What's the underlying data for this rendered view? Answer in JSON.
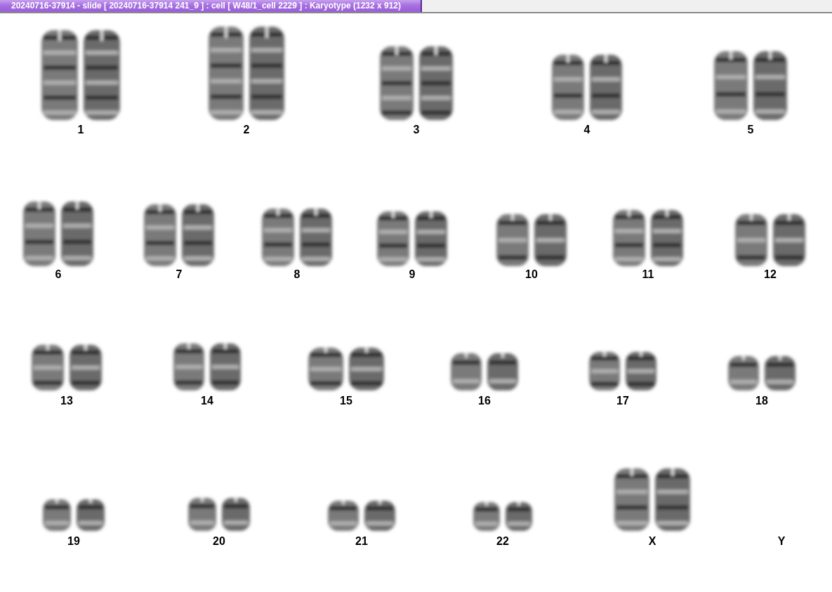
{
  "window": {
    "title": "20240716-37914 - slide [ 20240716-37914 241_9 ] : cell [ W48/1_cell 2229 ] : Karyotype  (1232 x 912)"
  },
  "karyotype": [
    {
      "label": "1",
      "pair_shown": true
    },
    {
      "label": "2",
      "pair_shown": true
    },
    {
      "label": "3",
      "pair_shown": true
    },
    {
      "label": "4",
      "pair_shown": true
    },
    {
      "label": "5",
      "pair_shown": true
    },
    {
      "label": "6",
      "pair_shown": true
    },
    {
      "label": "7",
      "pair_shown": true
    },
    {
      "label": "8",
      "pair_shown": true
    },
    {
      "label": "9",
      "pair_shown": true
    },
    {
      "label": "10",
      "pair_shown": true
    },
    {
      "label": "11",
      "pair_shown": true
    },
    {
      "label": "12",
      "pair_shown": true
    },
    {
      "label": "13",
      "pair_shown": true
    },
    {
      "label": "14",
      "pair_shown": true
    },
    {
      "label": "15",
      "pair_shown": true
    },
    {
      "label": "16",
      "pair_shown": true
    },
    {
      "label": "17",
      "pair_shown": true
    },
    {
      "label": "18",
      "pair_shown": true
    },
    {
      "label": "19",
      "pair_shown": true
    },
    {
      "label": "20",
      "pair_shown": true
    },
    {
      "label": "21",
      "pair_shown": true
    },
    {
      "label": "22",
      "pair_shown": true
    },
    {
      "label": "X",
      "pair_shown": true
    },
    {
      "label": "Y",
      "pair_shown": false
    }
  ]
}
